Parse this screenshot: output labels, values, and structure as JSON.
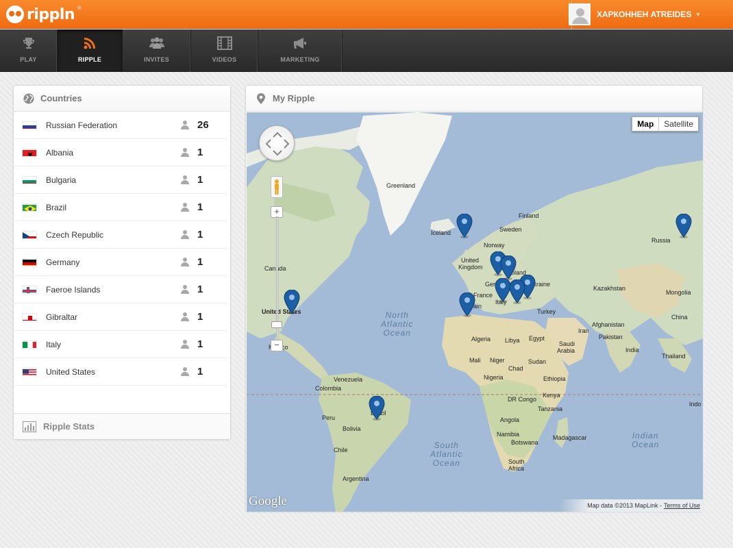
{
  "brand": {
    "name": "rippln",
    "tm": "®"
  },
  "user": {
    "name": "ХАРКОННЕН ATREIDES"
  },
  "nav": [
    {
      "id": "play",
      "label": "PLAY",
      "icon": "trophy-icon"
    },
    {
      "id": "ripple",
      "label": "RIPPLE",
      "icon": "rss-icon",
      "active": true
    },
    {
      "id": "invites",
      "label": "INVITES",
      "icon": "users-icon"
    },
    {
      "id": "videos",
      "label": "VIDEOS",
      "icon": "film-icon"
    },
    {
      "id": "marketing",
      "label": "MARKETING",
      "icon": "megaphone-icon"
    }
  ],
  "countries_panel": {
    "title": "Countries",
    "items": [
      {
        "name": "Russian Federation",
        "count": "26",
        "flag": "ru"
      },
      {
        "name": "Albania",
        "count": "1",
        "flag": "al"
      },
      {
        "name": "Bulgaria",
        "count": "1",
        "flag": "bg"
      },
      {
        "name": "Brazil",
        "count": "1",
        "flag": "br"
      },
      {
        "name": "Czech Republic",
        "count": "1",
        "flag": "cz"
      },
      {
        "name": "Germany",
        "count": "1",
        "flag": "de"
      },
      {
        "name": "Faeroe Islands",
        "count": "1",
        "flag": "fo"
      },
      {
        "name": "Gibraltar",
        "count": "1",
        "flag": "gi"
      },
      {
        "name": "Italy",
        "count": "1",
        "flag": "it"
      },
      {
        "name": "United States",
        "count": "1",
        "flag": "us"
      }
    ],
    "stats_title": "Ripple Stats"
  },
  "ripple_panel": {
    "title": "My Ripple",
    "map_type": {
      "map": "Map",
      "satellite": "Satellite"
    },
    "google": "Google",
    "attribution": {
      "text": "Map data ©2013 MapLink -",
      "terms": "Terms of Use"
    },
    "places": {
      "greenland": "Greenland",
      "iceland": "Iceland",
      "finland": "Finland",
      "sweden": "Sweden",
      "norway": "Norway",
      "uk1": "United",
      "uk2": "Kingdom",
      "germany": "Germany",
      "poland": "Poland",
      "ukraine": "Ukraine",
      "france": "France",
      "spain": "Spain",
      "italy": "Italy",
      "russia": "Russia",
      "kazakhstan": "Kazakhstan",
      "mongolia": "Mongolia",
      "china": "China",
      "turkey": "Turkey",
      "iran": "Iran",
      "afghanistan": "Afghanistan",
      "pakistan": "Pakistan",
      "india": "India",
      "thailand": "Thailand",
      "indonesia": "Indo",
      "canada": "Canada",
      "usa": "United States",
      "mexico": "Mexico",
      "algeria": "Algeria",
      "libya": "Libya",
      "egypt": "Egypt",
      "saudi1": "Saudi",
      "saudi2": "Arabia",
      "mali": "Mali",
      "niger": "Niger",
      "chad": "Chad",
      "sudan": "Sudan",
      "nigeria": "Nigeria",
      "ethiopia": "Ethiopia",
      "drc": "DR Congo",
      "kenya": "Kenya",
      "tanzania": "Tanzania",
      "angola": "Angola",
      "namibia": "Namibia",
      "botswana": "Botswana",
      "madagascar": "Madagascar",
      "sa1": "South",
      "sa2": "Africa",
      "venezuela": "Venezuela",
      "colombia": "Colombia",
      "peru": "Peru",
      "brazil": "Brazil",
      "bolivia": "Bolivia",
      "chile": "Chile",
      "argentina": "Argentina"
    },
    "oceans": {
      "north_atlantic": "North\nAtlantic\nOcean",
      "south_atlantic": "South\nAtlantic\nOcean",
      "indian": "Indian\nOcean"
    }
  }
}
